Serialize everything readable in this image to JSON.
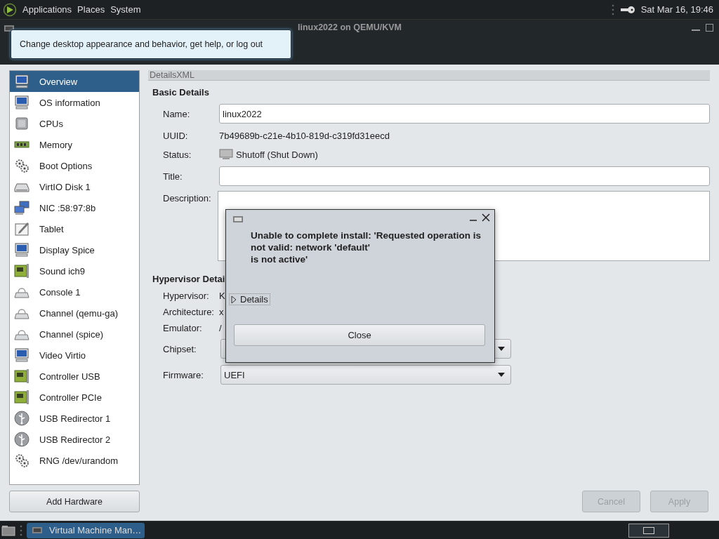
{
  "top_panel": {
    "menus": [
      "Applications",
      "Places",
      "System"
    ],
    "clock": "Sat Mar 16, 19:46"
  },
  "tooltip": "Change desktop appearance and behavior, get help, or log out",
  "window": {
    "title": "linux2022 on QEMU/KVM"
  },
  "sidebar": {
    "items": [
      {
        "label": "Overview",
        "kind": "monitor",
        "selected": true
      },
      {
        "label": "OS information",
        "kind": "monitor",
        "selected": false
      },
      {
        "label": "CPUs",
        "kind": "chip",
        "selected": false
      },
      {
        "label": "Memory",
        "kind": "memory",
        "selected": false
      },
      {
        "label": "Boot Options",
        "kind": "gears",
        "selected": false
      },
      {
        "label": "VirtIO Disk 1",
        "kind": "disk",
        "selected": false
      },
      {
        "label": "NIC :58:97:8b",
        "kind": "network",
        "selected": false
      },
      {
        "label": "Tablet",
        "kind": "tablet",
        "selected": false
      },
      {
        "label": "Display Spice",
        "kind": "monitor",
        "selected": false
      },
      {
        "label": "Sound ich9",
        "kind": "card",
        "selected": false
      },
      {
        "label": "Console 1",
        "kind": "serial",
        "selected": false
      },
      {
        "label": "Channel (qemu-ga)",
        "kind": "serial",
        "selected": false
      },
      {
        "label": "Channel (spice)",
        "kind": "serial",
        "selected": false
      },
      {
        "label": "Video Virtio",
        "kind": "monitor",
        "selected": false
      },
      {
        "label": "Controller USB",
        "kind": "card",
        "selected": false
      },
      {
        "label": "Controller PCIe",
        "kind": "card",
        "selected": false
      },
      {
        "label": "USB Redirector 1",
        "kind": "usb",
        "selected": false
      },
      {
        "label": "USB Redirector 2",
        "kind": "usb",
        "selected": false
      },
      {
        "label": "RNG /dev/urandom",
        "kind": "gears",
        "selected": false
      }
    ],
    "add_button": "Add Hardware"
  },
  "tabs": [
    {
      "label": "Details"
    },
    {
      "label": "XML"
    }
  ],
  "sections": [
    {
      "heading": "Basic Details",
      "fields": [
        {
          "label": "Name:",
          "kind": "entry",
          "value": "linux2022"
        },
        {
          "label": "UUID:",
          "kind": "text",
          "value": "7b49689b-c21e-4b10-819d-c319fd31eecd"
        },
        {
          "label": "Status:",
          "kind": "status",
          "value": "Shutoff (Shut Down)"
        },
        {
          "label": "Title:",
          "kind": "entry"
        },
        {
          "label": "Description:",
          "kind": "textarea"
        }
      ]
    },
    {
      "heading": "Hypervisor Detai",
      "fields": [
        {
          "label": "Hypervisor:",
          "kind": "text",
          "value": "K"
        },
        {
          "label": "Architecture:",
          "kind": "text",
          "value": "x"
        },
        {
          "label": "Emulator:",
          "kind": "text",
          "value": "/"
        },
        {
          "label": "Chipset:",
          "kind": "combo"
        },
        {
          "label": "Firmware:",
          "kind": "combo",
          "value": "UEFI"
        }
      ]
    }
  ],
  "buttons": [
    {
      "label": "Cancel",
      "disabled": true
    },
    {
      "label": "Apply",
      "disabled": true
    }
  ],
  "dialog": {
    "message": "Unable to complete install: 'Requested operation is\nnot valid: network 'default'\nis not active'",
    "expander": {
      "label": "Details",
      "expanded": false
    },
    "button": "Close"
  },
  "taskbar": {
    "task": {
      "label": "Virtual Machine Man…",
      "selected": true
    }
  }
}
